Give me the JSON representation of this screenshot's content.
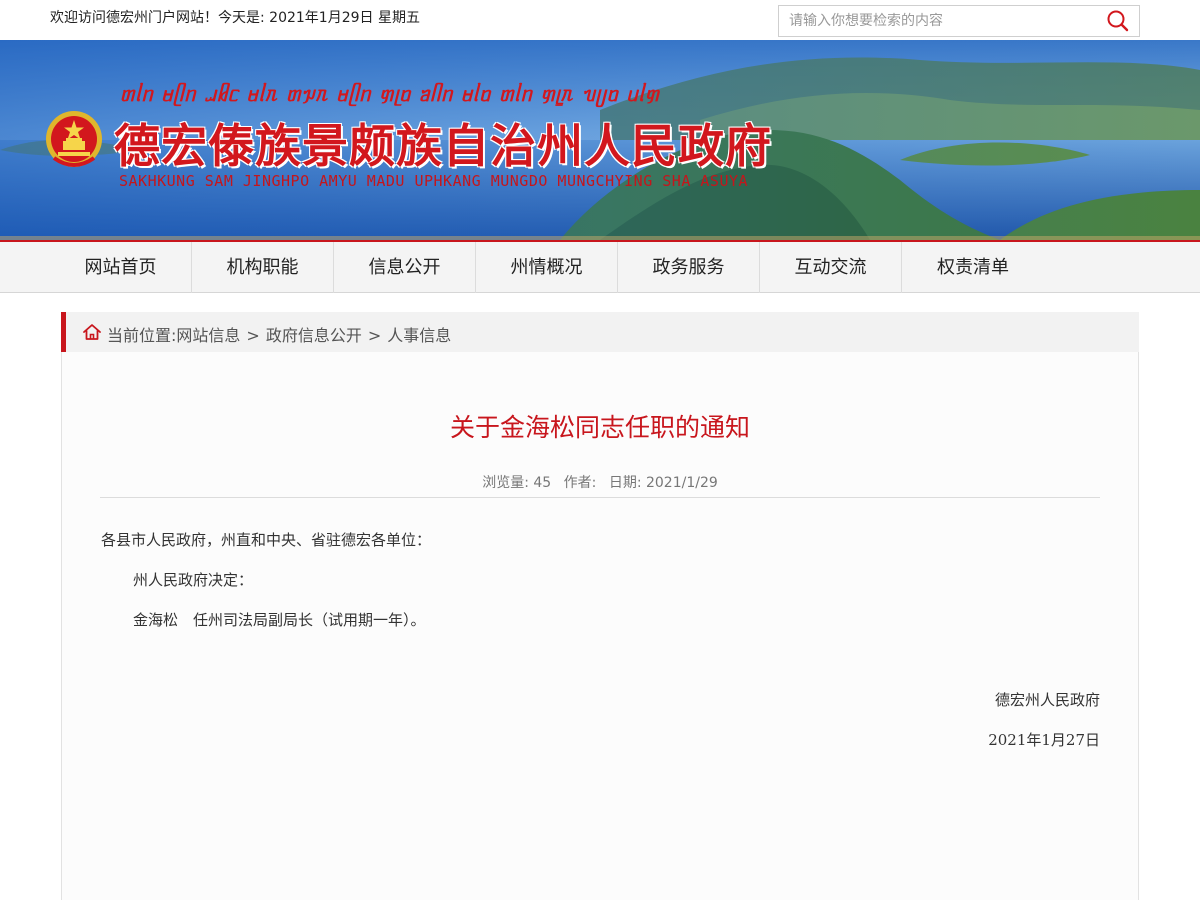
{
  "topbar": {
    "welcome": "欢迎访问德宏州门户网站！今天是: 2021年1月29日 星期五",
    "search_placeholder": "请输入你想要检索的内容",
    "search_icon": "search-icon"
  },
  "banner": {
    "dai_script": "ᥖᥣᥒ ᥛᥫᥒ ᥘᥤᥴ ᥛᥣᥰ ᥖᥭᥰ ᥛᥫᥒ ᥞᥨᥝ ᥑᥥᥒ ᥛᥣᥝ ᥖᥣᥒ ᥞᥧᥰ ᥔᥩᥝ ᥙᥣᥞ",
    "title": "德宏傣族景颇族自治州人民政府",
    "subtitle": "SAKHKUNG SAM JINGHPO AMYU MADU UPHKANG MUNGDO MUNGCHYING SHA ASUYA",
    "emblem_icon": "national-emblem-icon"
  },
  "nav": {
    "items": [
      "网站首页",
      "机构职能",
      "信息公开",
      "州情概况",
      "政务服务",
      "互动交流",
      "权责清单"
    ]
  },
  "breadcrumb": {
    "prefix": "当前位置:网站信息",
    "sep": ">",
    "level2": "政府信息公开",
    "level3": "人事信息"
  },
  "article": {
    "title": "关于金海松同志任职的通知",
    "views_label": "浏览量: 45",
    "author_label": "作者:",
    "date_label": "日期: 2021/1/29",
    "p1": "各县市人民政府，州直和中央、省驻德宏各单位：",
    "p2": "州人民政府决定：",
    "p3": "金海松　任州司法局副局长（试用期一年）。",
    "signature": "德宏州人民政府",
    "sign_date": "2021年1月27日"
  },
  "colors": {
    "accent_red": "#c8161d",
    "nav_bg": "#f4f4f4"
  }
}
